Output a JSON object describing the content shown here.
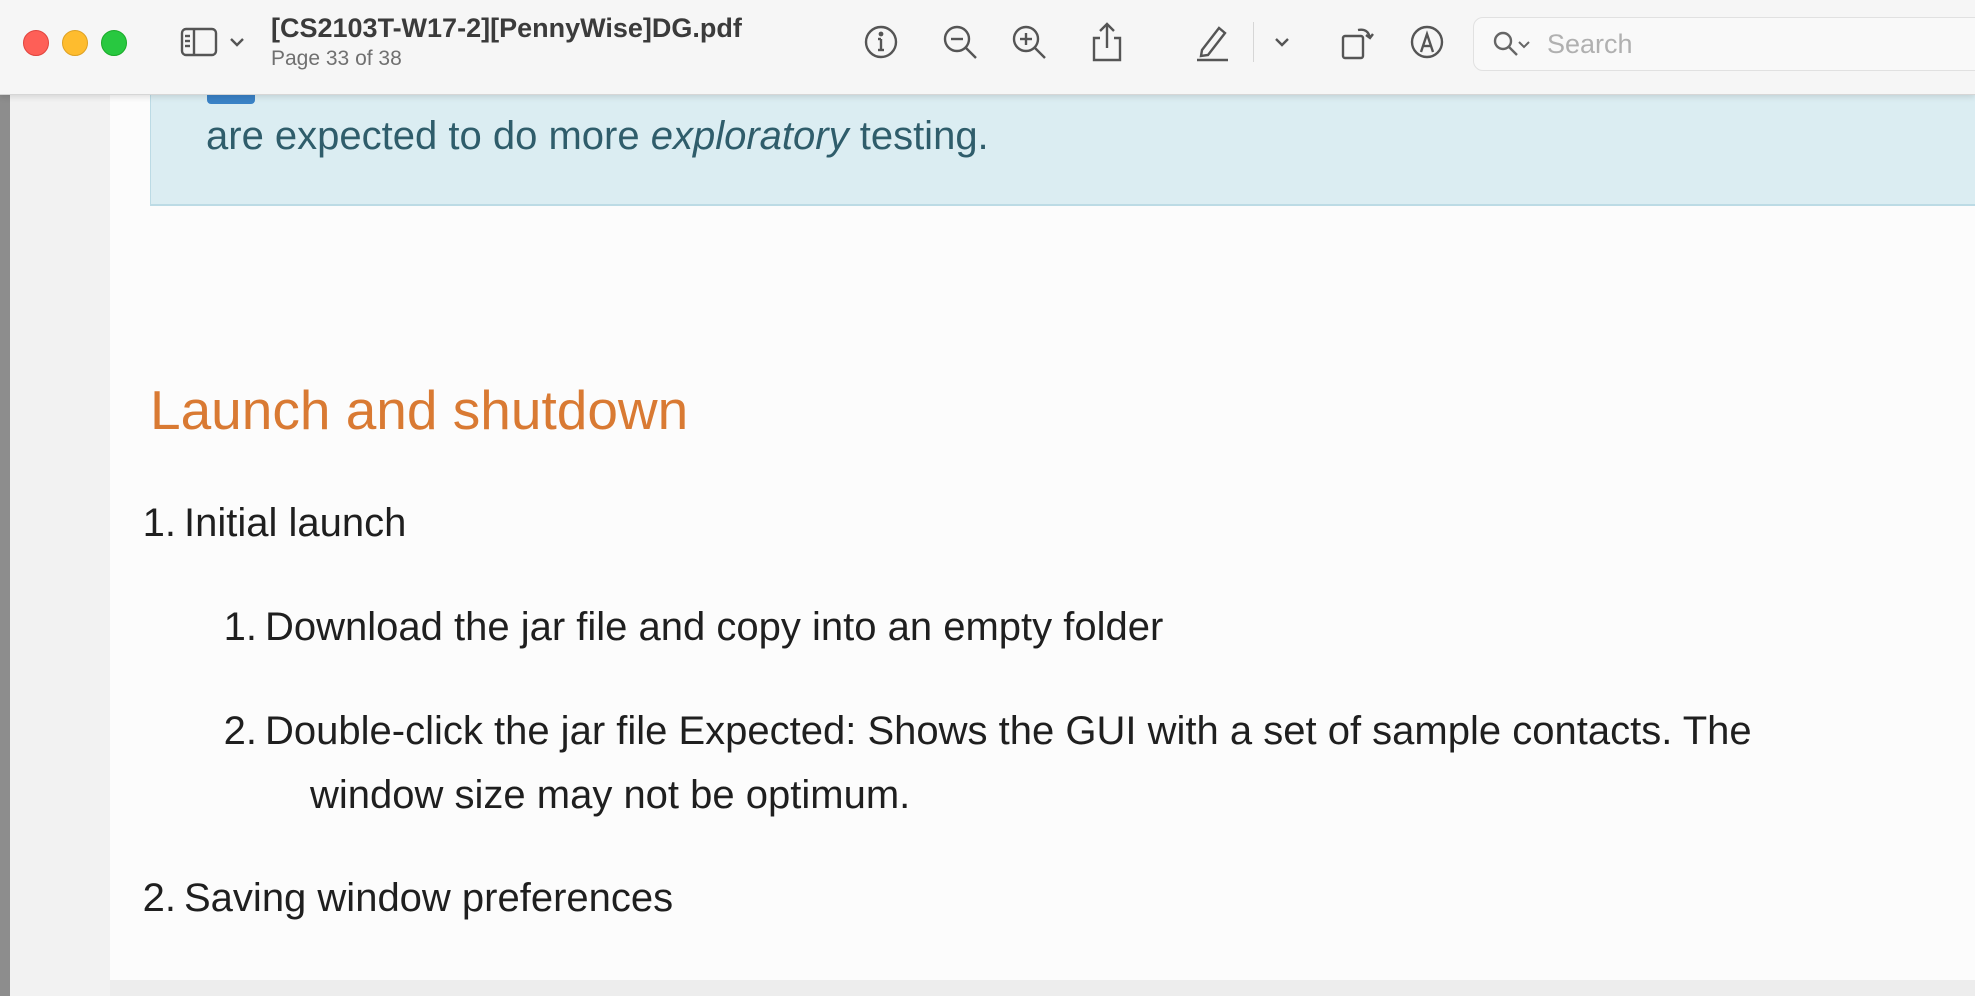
{
  "window": {
    "title": "[CS2103T-W17-2][PennyWise]DG.pdf",
    "page_info": "Page 33 of 38"
  },
  "toolbar": {
    "icons": [
      "sidebar-icon",
      "chevron-down-icon",
      "info-icon",
      "zoom-out-icon",
      "zoom-in-icon",
      "share-icon",
      "highlight-pen-icon",
      "chevron-down-icon",
      "rotate-icon",
      "markup-icon"
    ]
  },
  "search": {
    "placeholder": "Search"
  },
  "document": {
    "callout": {
      "line_prefix": "are expected to do more ",
      "line_italic": "exploratory",
      "line_suffix": " testing."
    },
    "heading": "Launch and shutdown",
    "items": [
      {
        "num": "1.",
        "label": "Initial launch",
        "subitems": [
          {
            "num": "1.",
            "text": "Download the jar file and copy into an empty folder"
          },
          {
            "num": "2.",
            "text": "Double-click the jar file Expected: Shows the GUI with a set of sample contacts. The",
            "text_cont": "window size may not be optimum."
          }
        ]
      },
      {
        "num": "2.",
        "label": "Saving window preferences"
      }
    ]
  },
  "colors": {
    "heading": "#d97a33",
    "callout_bg": "#dbedf2",
    "callout_text": "#2f5d6b"
  }
}
